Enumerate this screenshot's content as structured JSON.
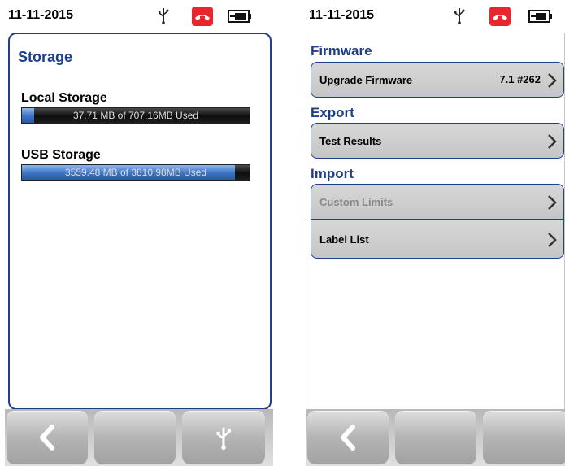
{
  "left_screen": {
    "status": {
      "date": "11-11-2015"
    },
    "title": "Storage",
    "local": {
      "label": "Local Storage",
      "bar_text": "37.71 MB of 707.16MB Used",
      "fraction_used": 0.053
    },
    "usb": {
      "label": "USB Storage",
      "bar_text": "3559.48 MB of 3810.98MB Used",
      "fraction_used": 0.934
    },
    "bottom_buttons": [
      {
        "icon": "back-arrow-icon"
      },
      {
        "icon": ""
      },
      {
        "icon": "usb-icon"
      }
    ]
  },
  "right_screen": {
    "status": {
      "date": "11-11-2015"
    },
    "sections": {
      "firmware": "Firmware",
      "export": "Export",
      "import": "Import"
    },
    "items": {
      "upgrade_firmware": {
        "label": "Upgrade Firmware",
        "value": "7.1 #262"
      },
      "test_results": {
        "label": "Test Results"
      },
      "custom_limits": {
        "label": "Custom Limits",
        "disabled": true
      },
      "label_list": {
        "label": "Label List"
      }
    },
    "bottom_buttons": [
      {
        "icon": "back-arrow-icon"
      },
      {
        "icon": ""
      },
      {
        "icon": ""
      }
    ]
  },
  "colors": {
    "accent": "#1f3f8c",
    "alert": "#e8262b",
    "bar_fill": "#3c73c4"
  }
}
